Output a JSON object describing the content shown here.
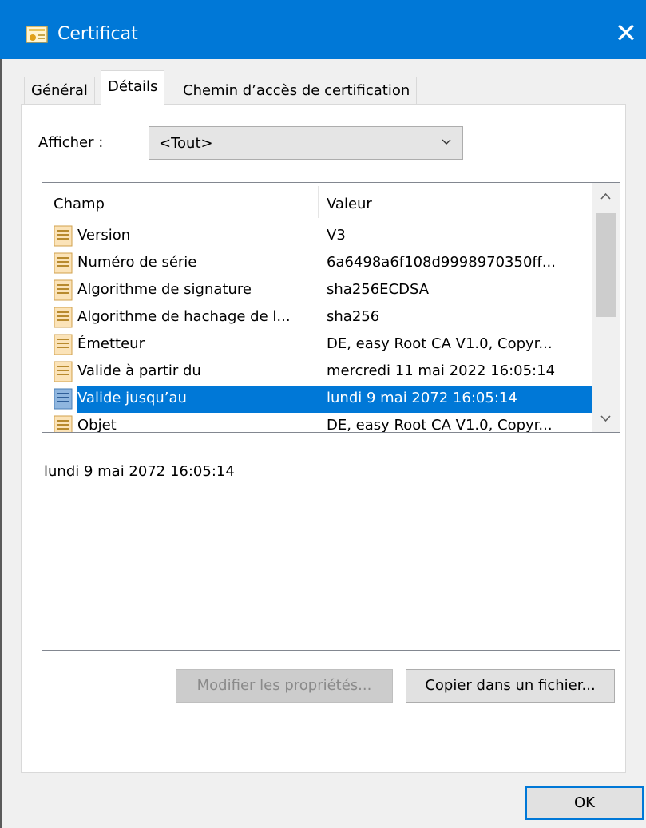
{
  "window": {
    "title": "Certificat",
    "close_glyph": "✕",
    "accent": "#0078d7"
  },
  "tabs": [
    {
      "label": "Général"
    },
    {
      "label": "Détails"
    },
    {
      "label": "Chemin d’accès de certification"
    }
  ],
  "show": {
    "label": "Afficher :",
    "selected": "<Tout>"
  },
  "list": {
    "columns": [
      "Champ",
      "Valeur"
    ],
    "rows": [
      {
        "field": "Version",
        "value": "V3"
      },
      {
        "field": "Numéro de série",
        "value": "6a6498a6f108d9998970350ff..."
      },
      {
        "field": "Algorithme de signature",
        "value": "sha256ECDSA"
      },
      {
        "field": "Algorithme de hachage de l...",
        "value": "sha256"
      },
      {
        "field": "Émetteur",
        "value": "DE, easy Root CA V1.0, Copyr..."
      },
      {
        "field": "Valide à partir du",
        "value": "mercredi 11 mai 2022 16:05:14"
      },
      {
        "field": "Valide jusqu’au",
        "value": "lundi 9 mai 2072 16:05:14",
        "selected": true
      },
      {
        "field": "Objet",
        "value": "DE, easy Root CA V1.0, Copyr..."
      }
    ]
  },
  "detail": {
    "text": "lundi 9 mai 2072 16:05:14"
  },
  "buttons": {
    "modify": "Modifier les propriétés...",
    "copy": "Copier dans un fichier...",
    "ok": "OK"
  },
  "icons": {
    "app": "certificate-icon",
    "row": "certificate-field-icon",
    "chevron": "chevron-down-icon"
  }
}
